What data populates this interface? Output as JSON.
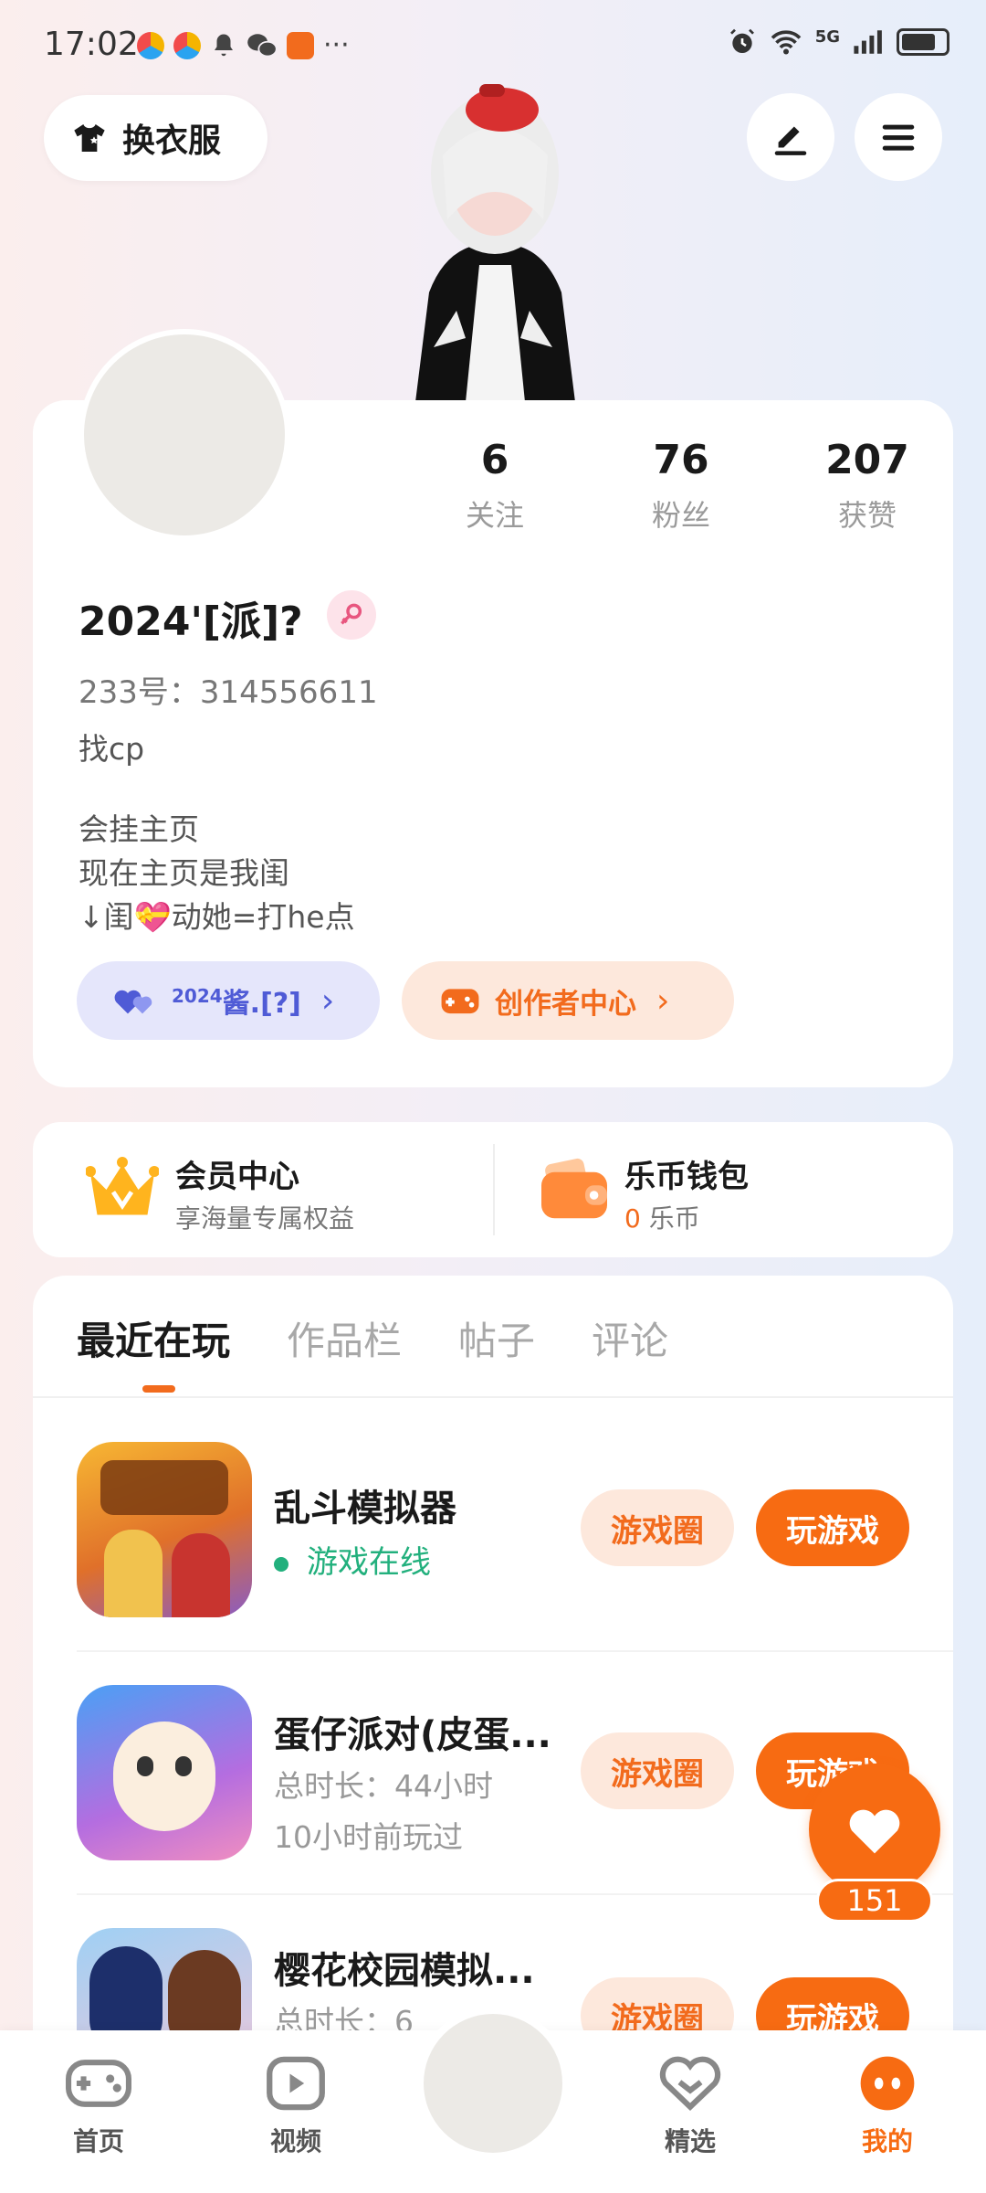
{
  "status_bar": {
    "time": "17:02",
    "more": "···",
    "network": "5G"
  },
  "header": {
    "outfit_label": "换衣服"
  },
  "profile": {
    "stats": [
      {
        "value": "6",
        "label": "关注"
      },
      {
        "value": "76",
        "label": "粉丝"
      },
      {
        "value": "207",
        "label": "获赞"
      }
    ],
    "nickname": "2024'[派]?",
    "uid": "233号：314556611",
    "bio_line1": "找cp",
    "bio_line2": "会挂主页",
    "bio_line3": "现在主页是我闺",
    "bio_line4": "↓闺💝动她=打he点",
    "fan_badge_sup": "2024",
    "fan_badge_text": "酱.[?]",
    "creator_center": "创作者中心",
    "chevron": "›"
  },
  "vip": {
    "member_title": "会员中心",
    "member_sub": "享海量专属权益",
    "wallet_title": "乐币钱包",
    "wallet_amount": "0",
    "wallet_unit": "乐币"
  },
  "tabs": [
    "最近在玩",
    "作品栏",
    "帖子",
    "评论"
  ],
  "games": [
    {
      "name": "乱斗模拟器",
      "status": "游戏在线",
      "circle_label": "游戏圈",
      "play_label": "玩游戏"
    },
    {
      "name": "蛋仔派对(皮蛋...",
      "duration": "总时长：44小时",
      "last_played": "10小时前玩过",
      "circle_label": "游戏圈",
      "play_label": "玩游戏"
    },
    {
      "name": "樱花校园模拟...",
      "duration": "总时长：6",
      "circle_label": "游戏圈",
      "play_label": "玩游戏"
    }
  ],
  "like_fab": {
    "count": "151"
  },
  "bottom_nav": [
    {
      "label": "首页",
      "icon": "gamepad-icon"
    },
    {
      "label": "视频",
      "icon": "video-icon"
    },
    {
      "label": "精选",
      "icon": "heart-icon"
    },
    {
      "label": "我的",
      "icon": "me-icon"
    }
  ],
  "colors": {
    "accent": "#f76b12",
    "online": "#22b07d",
    "fan_badge": "#4f5bd6"
  }
}
